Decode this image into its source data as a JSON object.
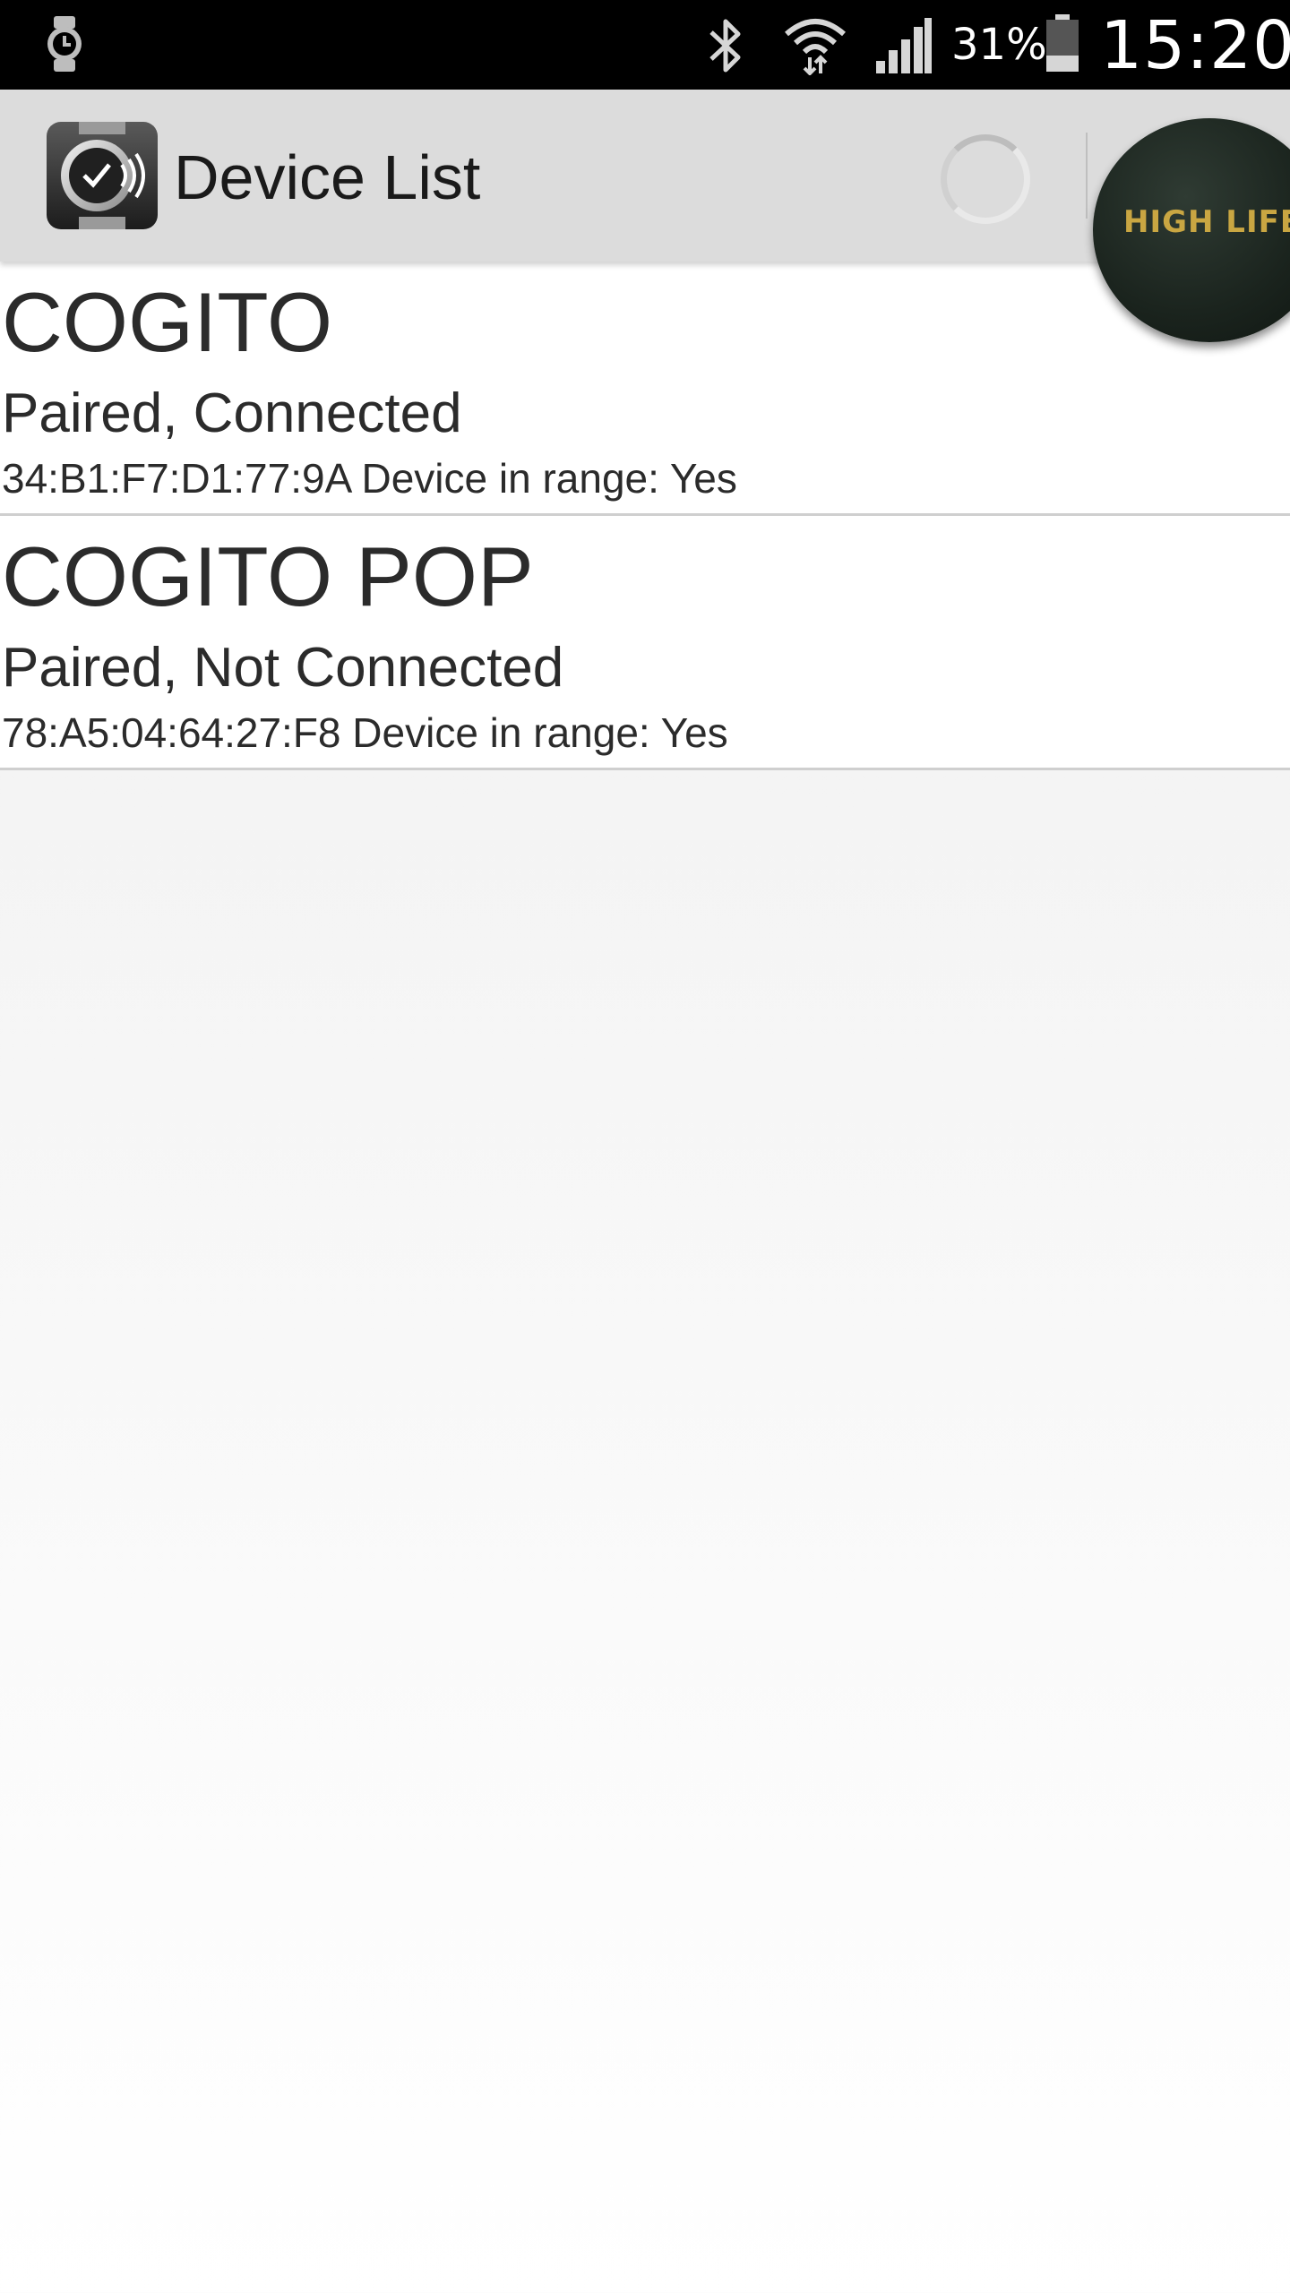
{
  "status_bar": {
    "notification_icon": "watch-notification-icon",
    "bluetooth_icon": "bluetooth-icon",
    "wifi_icon": "wifi-icon",
    "signal_icon": "cell-signal-icon",
    "battery_percent": "31%",
    "battery_level": 0.31,
    "battery_icon": "battery-icon",
    "time": "15:20"
  },
  "app_bar": {
    "logo_icon": "watch-app-logo-icon",
    "title": "Device List",
    "progress_icon": "loading-spinner-icon",
    "badge_text": "HIGH LIFE"
  },
  "devices": [
    {
      "name": "COGITO",
      "status": "Paired, Connected",
      "info": "34:B1:F7:D1:77:9A Device in range: Yes"
    },
    {
      "name": "COGITO POP",
      "status": "Paired, Not Connected",
      "info": "78:A5:04:64:27:F8 Device in range: Yes"
    }
  ],
  "colors": {
    "status_bar_bg": "#000000",
    "app_bar_bg": "#dcdcdc",
    "text_primary": "#2b2b2b",
    "badge_text": "#c9a642"
  }
}
